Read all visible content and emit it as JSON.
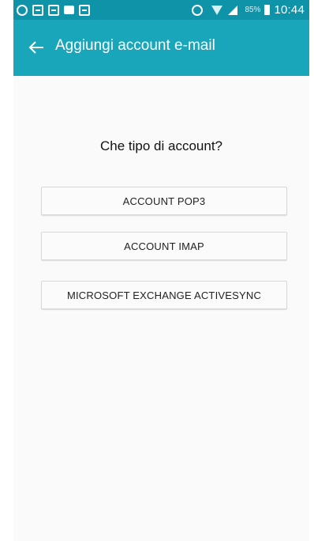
{
  "status_bar": {
    "time": "10:44",
    "battery_percent": "85%",
    "left_icons": [
      "whatsapp-icon",
      "image-notification-icon",
      "cast-notification-icon",
      "gallery-notification-icon",
      "calendar-notification-icon"
    ],
    "right_icons": [
      "alarm-icon",
      "wifi-icon",
      "signal-icon",
      "battery-icon"
    ]
  },
  "app_bar": {
    "back_icon": "arrow-back-icon",
    "title": "Aggiungi account e-mail"
  },
  "content": {
    "question": "Che tipo di account?",
    "buttons": [
      {
        "label": "ACCOUNT POP3"
      },
      {
        "label": "ACCOUNT IMAP"
      },
      {
        "label": "MICROSOFT EXCHANGE ACTIVESYNC"
      }
    ]
  },
  "colors": {
    "status_bar": "#0f93a9",
    "app_bar": "#19a6bb",
    "background": "#fafafa"
  }
}
